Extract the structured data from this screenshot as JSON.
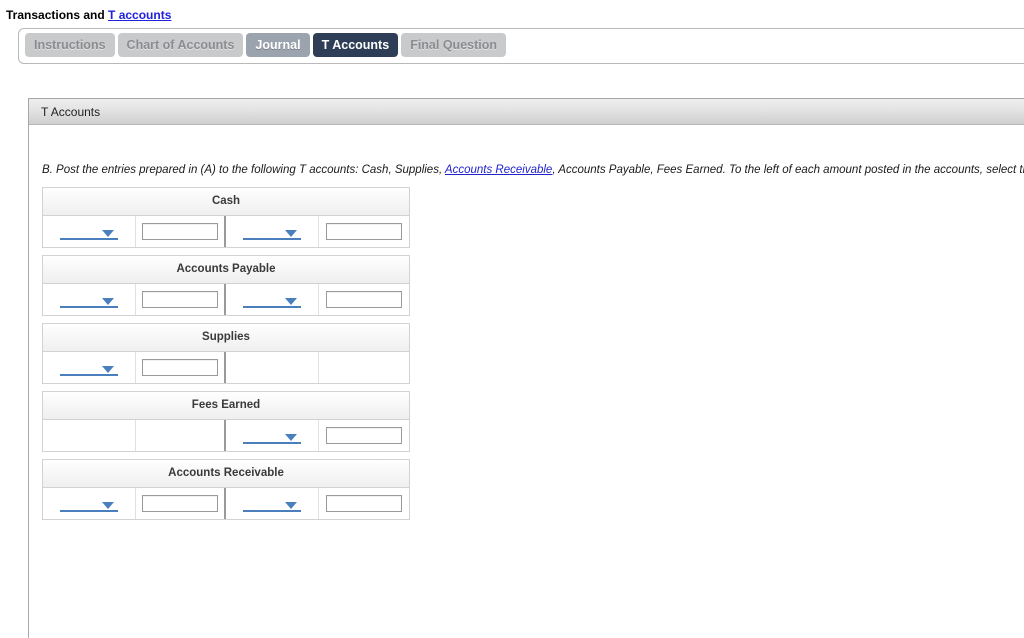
{
  "header": {
    "title_prefix": "Transactions and ",
    "title_link": "T accounts"
  },
  "tabs": [
    {
      "label": "Instructions",
      "state": "muted"
    },
    {
      "label": "Chart of Accounts",
      "state": "muted"
    },
    {
      "label": "Journal",
      "state": "semi"
    },
    {
      "label": "T Accounts",
      "state": "active"
    },
    {
      "label": "Final Question",
      "state": "muted"
    }
  ],
  "panel": {
    "header_title": "T Accounts",
    "instruction": {
      "part1": "B. Post the entries prepared in (A) to the following T accounts: Cash, Supplies, ",
      "link": "Accounts Receivable",
      "part2": ", Accounts Payable, Fees Earned. To the left of each amount posted in the accounts, select the appropriate date."
    }
  },
  "colors": {
    "accent_blue": "#4a7fbd",
    "link_blue": "#2222cc",
    "active_tab": "#2d3e56",
    "muted_tab": "#c9cacc",
    "semi_tab": "#9ba3ae"
  },
  "t_accounts": [
    {
      "name": "Cash",
      "debit_date_value": "",
      "debit_amount_value": "",
      "credit_date_value": "",
      "credit_amount_value": "",
      "has_debit": true,
      "has_credit": true
    },
    {
      "name": "Accounts Payable",
      "debit_date_value": "",
      "debit_amount_value": "",
      "credit_date_value": "",
      "credit_amount_value": "",
      "has_debit": true,
      "has_credit": true
    },
    {
      "name": "Supplies",
      "debit_date_value": "",
      "debit_amount_value": "",
      "credit_date_value": "",
      "credit_amount_value": "",
      "has_debit": true,
      "has_credit": false
    },
    {
      "name": "Fees Earned",
      "debit_date_value": "",
      "debit_amount_value": "",
      "credit_date_value": "",
      "credit_amount_value": "",
      "has_debit": false,
      "has_credit": true
    },
    {
      "name": "Accounts Receivable",
      "debit_date_value": "",
      "debit_amount_value": "",
      "credit_date_value": "",
      "credit_amount_value": "",
      "has_debit": true,
      "has_credit": true
    }
  ]
}
